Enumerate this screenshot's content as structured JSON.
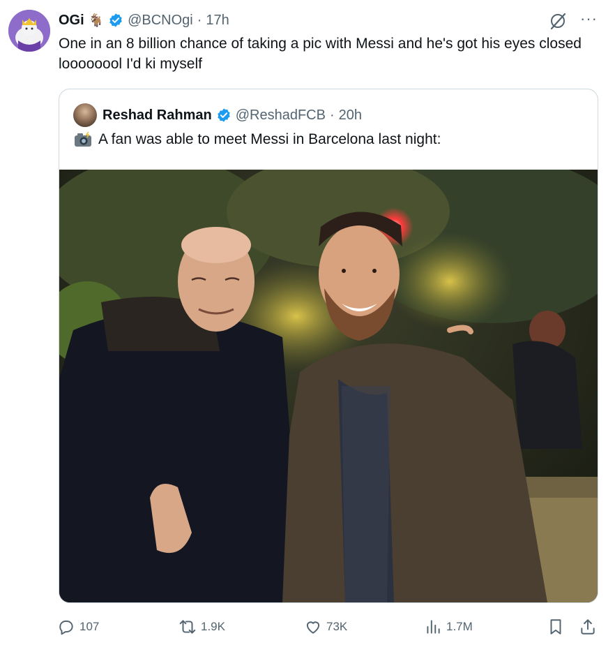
{
  "tweet": {
    "author_name": "OGi",
    "author_emoji": "🐐",
    "handle": "@BCNOgi",
    "separator": "·",
    "time": "17h",
    "text": "One in an 8 billion chance of taking a pic with Messi and he's got his eyes closed loooooool I'd ki myself",
    "more_label": "···"
  },
  "quoted": {
    "author_name": "Reshad Rahman",
    "handle": "@ReshadFCB",
    "separator": "·",
    "time": "20h",
    "text": "A fan was able to meet Messi in Barcelona last night:"
  },
  "actions": {
    "replies": "107",
    "reposts": "1.9K",
    "likes": "73K",
    "views": "1.7M"
  },
  "icons": {
    "verified": "verified-badge-icon",
    "grok": "grok-icon",
    "camera": "camera-with-flash-icon"
  },
  "colors": {
    "verified": "#1d9bf0",
    "secondary_text": "#536471",
    "border": "#cfd9de"
  }
}
